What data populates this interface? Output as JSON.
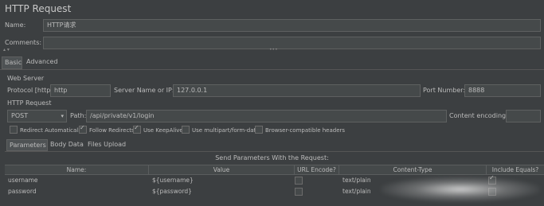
{
  "header": {
    "title": "HTTP Request"
  },
  "name": {
    "label": "Name:",
    "value": "HTTP请求"
  },
  "comments": {
    "label": "Comments:",
    "value": ""
  },
  "splitter": {
    "left_glyph": "▴ ▾",
    "center_glyph": "•••"
  },
  "main_tabs": [
    {
      "label": "Basic",
      "active": true
    },
    {
      "label": "Advanced",
      "active": false
    }
  ],
  "web_server": {
    "section_label": "Web Server",
    "protocol_label": "Protocol [http]:",
    "protocol_value": "http",
    "server_label": "Server Name or IP:",
    "server_value": "127.0.0.1",
    "port_label": "Port Number:",
    "port_value": "8888"
  },
  "http_request": {
    "section_label": "HTTP Request",
    "method_value": "POST",
    "path_label": "Path:",
    "path_value": "/api/private/v1/login",
    "encoding_label": "Content encoding:",
    "encoding_value": ""
  },
  "options": [
    {
      "label": "Redirect Automatically",
      "checked": false
    },
    {
      "label": "Follow Redirects",
      "checked": true
    },
    {
      "label": "Use KeepAlive",
      "checked": true
    },
    {
      "label": "Use multipart/form-data",
      "checked": false
    },
    {
      "label": "Browser-compatible headers",
      "checked": false
    }
  ],
  "sub_tabs": [
    {
      "label": "Parameters",
      "active": true
    },
    {
      "label": "Body Data",
      "active": false
    },
    {
      "label": "Files Upload",
      "active": false
    }
  ],
  "params": {
    "caption": "Send Parameters With the Request:",
    "columns": [
      "Name:",
      "Value",
      "URL Encode?",
      "Content-Type",
      "Include Equals?"
    ],
    "rows": [
      {
        "name": "username",
        "value": "${username}",
        "url_encode": false,
        "content_type": "text/plain",
        "include_equals": true
      },
      {
        "name": "password",
        "value": "${password}",
        "url_encode": false,
        "content_type": "text/plain",
        "include_equals": false
      }
    ]
  },
  "icons": {
    "dropdown": "▾"
  }
}
